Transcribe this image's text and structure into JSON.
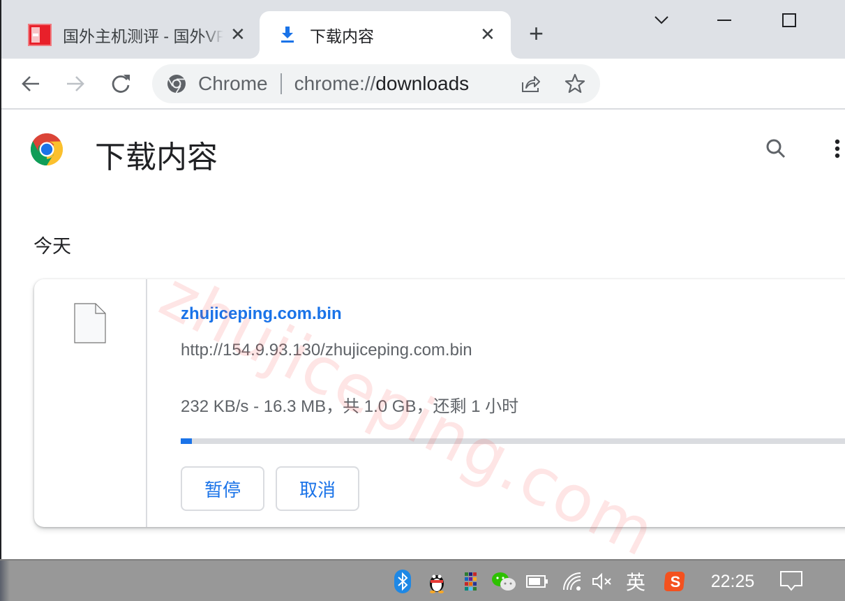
{
  "browser": {
    "tabs": [
      {
        "title": "国外主机测评 - 国外VPS",
        "active": false,
        "favicon": "site-logo-icon"
      },
      {
        "title": "下载内容",
        "active": true,
        "favicon": "download-icon"
      }
    ],
    "new_tab_label": "+",
    "window_controls": [
      "tab-search-icon",
      "minimize-icon",
      "maximize-icon"
    ]
  },
  "toolbar": {
    "back_icon": "arrow-left-icon",
    "forward_icon": "arrow-right-icon",
    "reload_icon": "reload-icon",
    "omnibox": {
      "site_chip": "Chrome",
      "url_scheme": "chrome://",
      "url_host": "downloads"
    }
  },
  "page": {
    "title": "下载内容",
    "section_date": "今天",
    "watermark": "zhujiceping.com",
    "downloads": [
      {
        "file_name": "zhujiceping.com.bin",
        "url": "http://154.9.93.130/zhujiceping.com.bin",
        "status": "232 KB/s - 16.3 MB，共 1.0 GB，还剩 1 小时",
        "progress_fraction": 0.016,
        "buttons": {
          "pause": "暂停",
          "cancel": "取消"
        }
      }
    ]
  },
  "taskbar": {
    "tray_icons": [
      "bluetooth-icon",
      "qq-icon",
      "app-grid-icon",
      "wechat-icon",
      "battery-icon",
      "wifi-icon",
      "volume-muted-icon"
    ],
    "ime_label": "英",
    "sogou_icon": "sogou-icon",
    "clock": "22:25",
    "notification_icon": "action-center-icon"
  },
  "colors": {
    "accent": "#1a73e8",
    "tabstrip_bg": "#dee1e6",
    "omnibox_bg": "#f1f3f4",
    "taskbar_bg": "#989898",
    "watermark": "#f55050"
  }
}
